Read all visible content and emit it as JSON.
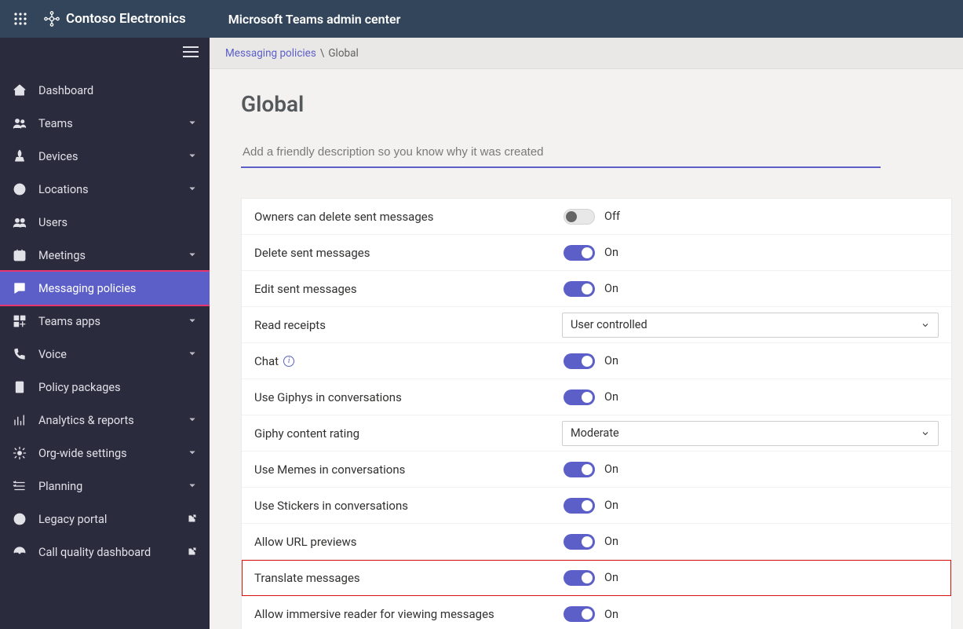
{
  "header": {
    "org_name": "Contoso Electronics",
    "suite_title": "Microsoft Teams admin center"
  },
  "sidebar": {
    "items": [
      {
        "icon": "home",
        "label": "Dashboard",
        "expandable": false,
        "external": false
      },
      {
        "icon": "teams",
        "label": "Teams",
        "expandable": true,
        "external": false
      },
      {
        "icon": "devices",
        "label": "Devices",
        "expandable": true,
        "external": false
      },
      {
        "icon": "globe",
        "label": "Locations",
        "expandable": true,
        "external": false
      },
      {
        "icon": "users",
        "label": "Users",
        "expandable": false,
        "external": false
      },
      {
        "icon": "calendar",
        "label": "Meetings",
        "expandable": true,
        "external": false
      },
      {
        "icon": "chat",
        "label": "Messaging policies",
        "expandable": false,
        "external": false,
        "active": true
      },
      {
        "icon": "apps",
        "label": "Teams apps",
        "expandable": true,
        "external": false
      },
      {
        "icon": "voice",
        "label": "Voice",
        "expandable": true,
        "external": false
      },
      {
        "icon": "policy",
        "label": "Policy packages",
        "expandable": false,
        "external": false
      },
      {
        "icon": "analytics",
        "label": "Analytics & reports",
        "expandable": true,
        "external": false
      },
      {
        "icon": "gear",
        "label": "Org-wide settings",
        "expandable": true,
        "external": false
      },
      {
        "icon": "planning",
        "label": "Planning",
        "expandable": true,
        "external": false
      },
      {
        "icon": "legacy",
        "label": "Legacy portal",
        "expandable": false,
        "external": true
      },
      {
        "icon": "dashboard",
        "label": "Call quality dashboard",
        "expandable": false,
        "external": true
      }
    ]
  },
  "breadcrumb": {
    "parent": "Messaging policies",
    "current": "Global"
  },
  "page": {
    "title": "Global",
    "description_placeholder": "Add a friendly description so you know why it was created"
  },
  "settings": [
    {
      "label": "Owners can delete sent messages",
      "type": "toggle",
      "value": false,
      "text_off": "Off",
      "text_on": "On"
    },
    {
      "label": "Delete sent messages",
      "type": "toggle",
      "value": true,
      "text_off": "Off",
      "text_on": "On"
    },
    {
      "label": "Edit sent messages",
      "type": "toggle",
      "value": true,
      "text_off": "Off",
      "text_on": "On"
    },
    {
      "label": "Read receipts",
      "type": "select",
      "value": "User controlled"
    },
    {
      "label": "Chat",
      "type": "toggle",
      "value": true,
      "text_off": "Off",
      "text_on": "On",
      "info": true
    },
    {
      "label": "Use Giphys in conversations",
      "type": "toggle",
      "value": true,
      "text_off": "Off",
      "text_on": "On"
    },
    {
      "label": "Giphy content rating",
      "type": "select",
      "value": "Moderate"
    },
    {
      "label": "Use Memes in conversations",
      "type": "toggle",
      "value": true,
      "text_off": "Off",
      "text_on": "On"
    },
    {
      "label": "Use Stickers in conversations",
      "type": "toggle",
      "value": true,
      "text_off": "Off",
      "text_on": "On"
    },
    {
      "label": "Allow URL previews",
      "type": "toggle",
      "value": true,
      "text_off": "Off",
      "text_on": "On"
    },
    {
      "label": "Translate messages",
      "type": "toggle",
      "value": true,
      "text_off": "Off",
      "text_on": "On",
      "highlight": true
    },
    {
      "label": "Allow immersive reader for viewing messages",
      "type": "toggle",
      "value": true,
      "text_off": "Off",
      "text_on": "On"
    }
  ]
}
